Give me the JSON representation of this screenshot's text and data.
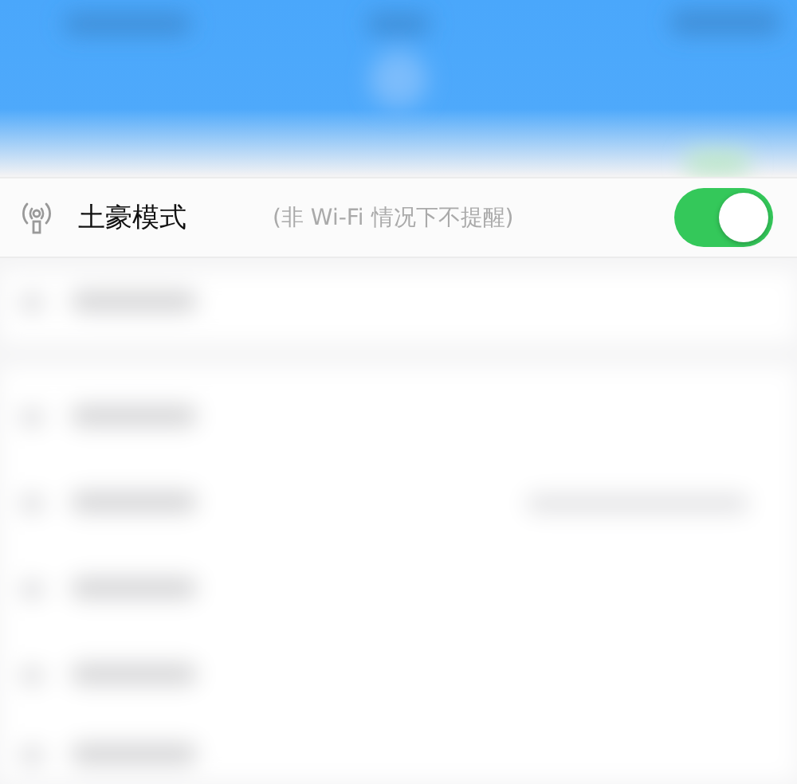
{
  "setting": {
    "label": "土豪模式",
    "hint": "(非 Wi-Fi 情况下不提醒)",
    "on": true
  }
}
